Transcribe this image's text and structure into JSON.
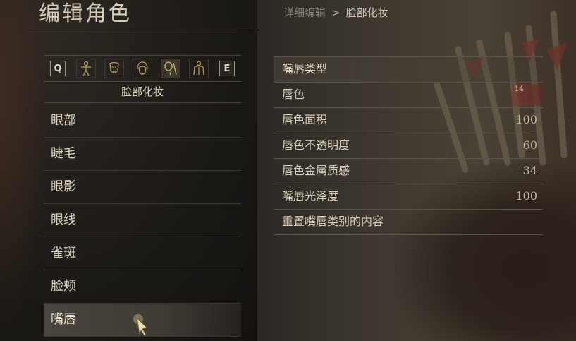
{
  "header": {
    "title": "编辑角色",
    "breadcrumb": {
      "parent": "详细编辑",
      "separator": ">",
      "current": "脸部化妆"
    }
  },
  "tabs": {
    "left_key": "Q",
    "right_key": "E",
    "icons": [
      "body-icon",
      "face-icon",
      "hair-icon",
      "makeup-icon",
      "torso-icon"
    ],
    "active": "makeup-icon"
  },
  "section_label": "脸部化妆",
  "menu": {
    "items": [
      {
        "label": "眼部"
      },
      {
        "label": "睫毛"
      },
      {
        "label": "眼影"
      },
      {
        "label": "眼线"
      },
      {
        "label": "雀斑"
      },
      {
        "label": "脸颊"
      },
      {
        "label": "嘴唇"
      }
    ],
    "selected": "嘴唇"
  },
  "options": {
    "header": "嘴唇类型",
    "lip_color": {
      "label": "唇色",
      "value": "14"
    },
    "lip_area": {
      "label": "唇色面积",
      "value": "100"
    },
    "lip_opacity": {
      "label": "唇色不透明度",
      "value": "60"
    },
    "lip_metallic": {
      "label": "唇色金属质感",
      "value": "34"
    },
    "lip_gloss": {
      "label": "嘴唇光泽度",
      "value": "100"
    },
    "reset": {
      "label": "重置嘴唇类别的内容"
    }
  },
  "colors": {
    "lip_swatch": "#7a3a30",
    "accent_text": "#d8d0bc"
  }
}
